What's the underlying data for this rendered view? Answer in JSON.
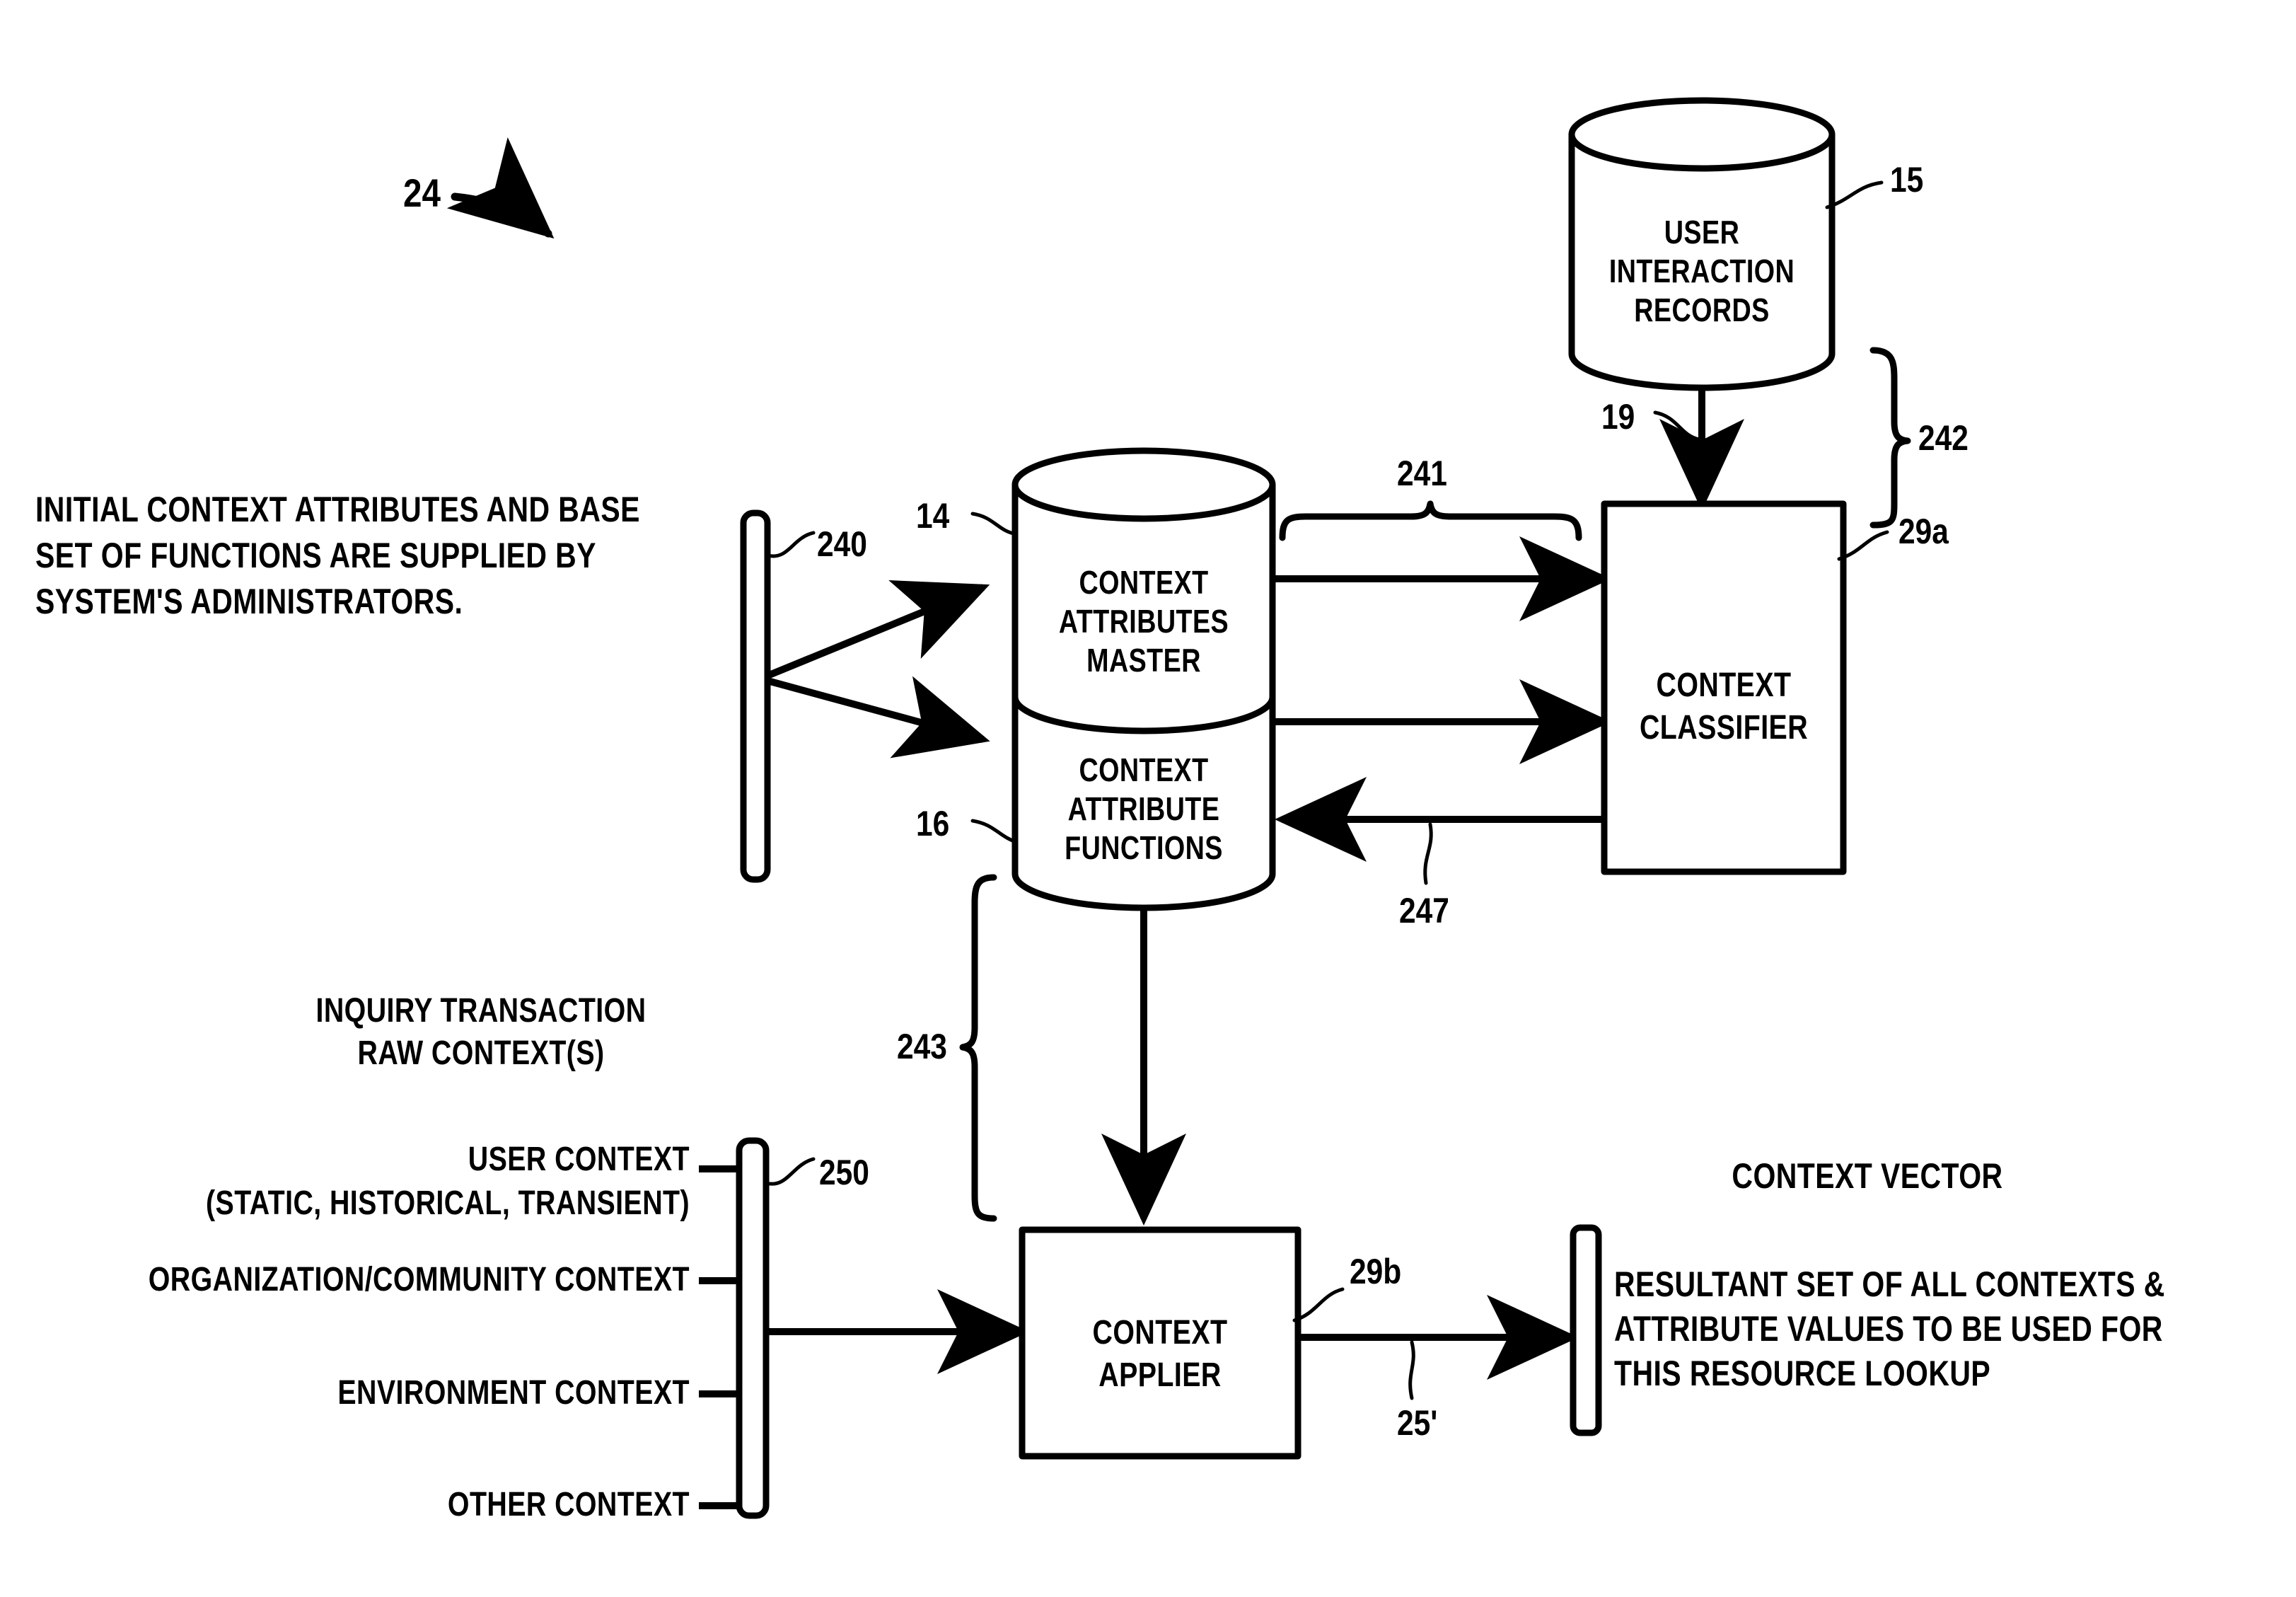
{
  "figure": {
    "label": "24"
  },
  "nodes": {
    "user_interaction_records": {
      "line1": "USER",
      "line2": "INTERACTION",
      "line3": "RECORDS",
      "ref": "15"
    },
    "context_attributes_master": {
      "line1": "CONTEXT",
      "line2": "ATTRIBUTES",
      "line3": "MASTER",
      "ref": "14"
    },
    "context_attribute_functions": {
      "line1": "CONTEXT",
      "line2": "ATTRIBUTE",
      "line3": "FUNCTIONS",
      "ref": "16"
    },
    "context_classifier": {
      "line1": "CONTEXT",
      "line2": "CLASSIFIER",
      "ref": "29a"
    },
    "context_applier": {
      "line1": "CONTEXT",
      "line2": "APPLIER",
      "ref": "29b"
    }
  },
  "bars": {
    "admin_input": {
      "ref": "240"
    },
    "raw_context_input": {
      "ref": "250"
    },
    "context_vector_output": {
      "ref": ""
    }
  },
  "annotations": {
    "admin_note": {
      "line1": "INITIAL CONTEXT ATTRIBUTES AND BASE",
      "line2": "SET OF FUNCTIONS ARE SUPPLIED BY",
      "line3": "SYSTEM'S ADMINISTRATORS."
    },
    "inquiry_heading": {
      "line1": "INQUIRY TRANSACTION",
      "line2": "RAW CONTEXT(S)"
    },
    "context_inputs": [
      {
        "label": "USER CONTEXT",
        "sub": "(STATIC, HISTORICAL, TRANSIENT)"
      },
      {
        "label": "ORGANIZATION/COMMUNITY CONTEXT",
        "sub": ""
      },
      {
        "label": "ENVIRONMENT CONTEXT",
        "sub": ""
      },
      {
        "label": "OTHER CONTEXT",
        "sub": ""
      }
    ],
    "context_vector_title": "CONTEXT VECTOR",
    "context_vector_body": {
      "line1": "RESULTANT SET OF ALL CONTEXTS &",
      "line2": "ATTRIBUTE VALUES TO BE USED FOR",
      "line3": "THIS RESOURCE LOOKUP"
    }
  },
  "refs": {
    "flow_241": "241",
    "flow_242": "242",
    "flow_243": "243",
    "flow_247": "247",
    "flow_19": "19",
    "flow_25prime": "25'"
  },
  "colors": {
    "ink": "#000000",
    "paper": "#ffffff"
  }
}
